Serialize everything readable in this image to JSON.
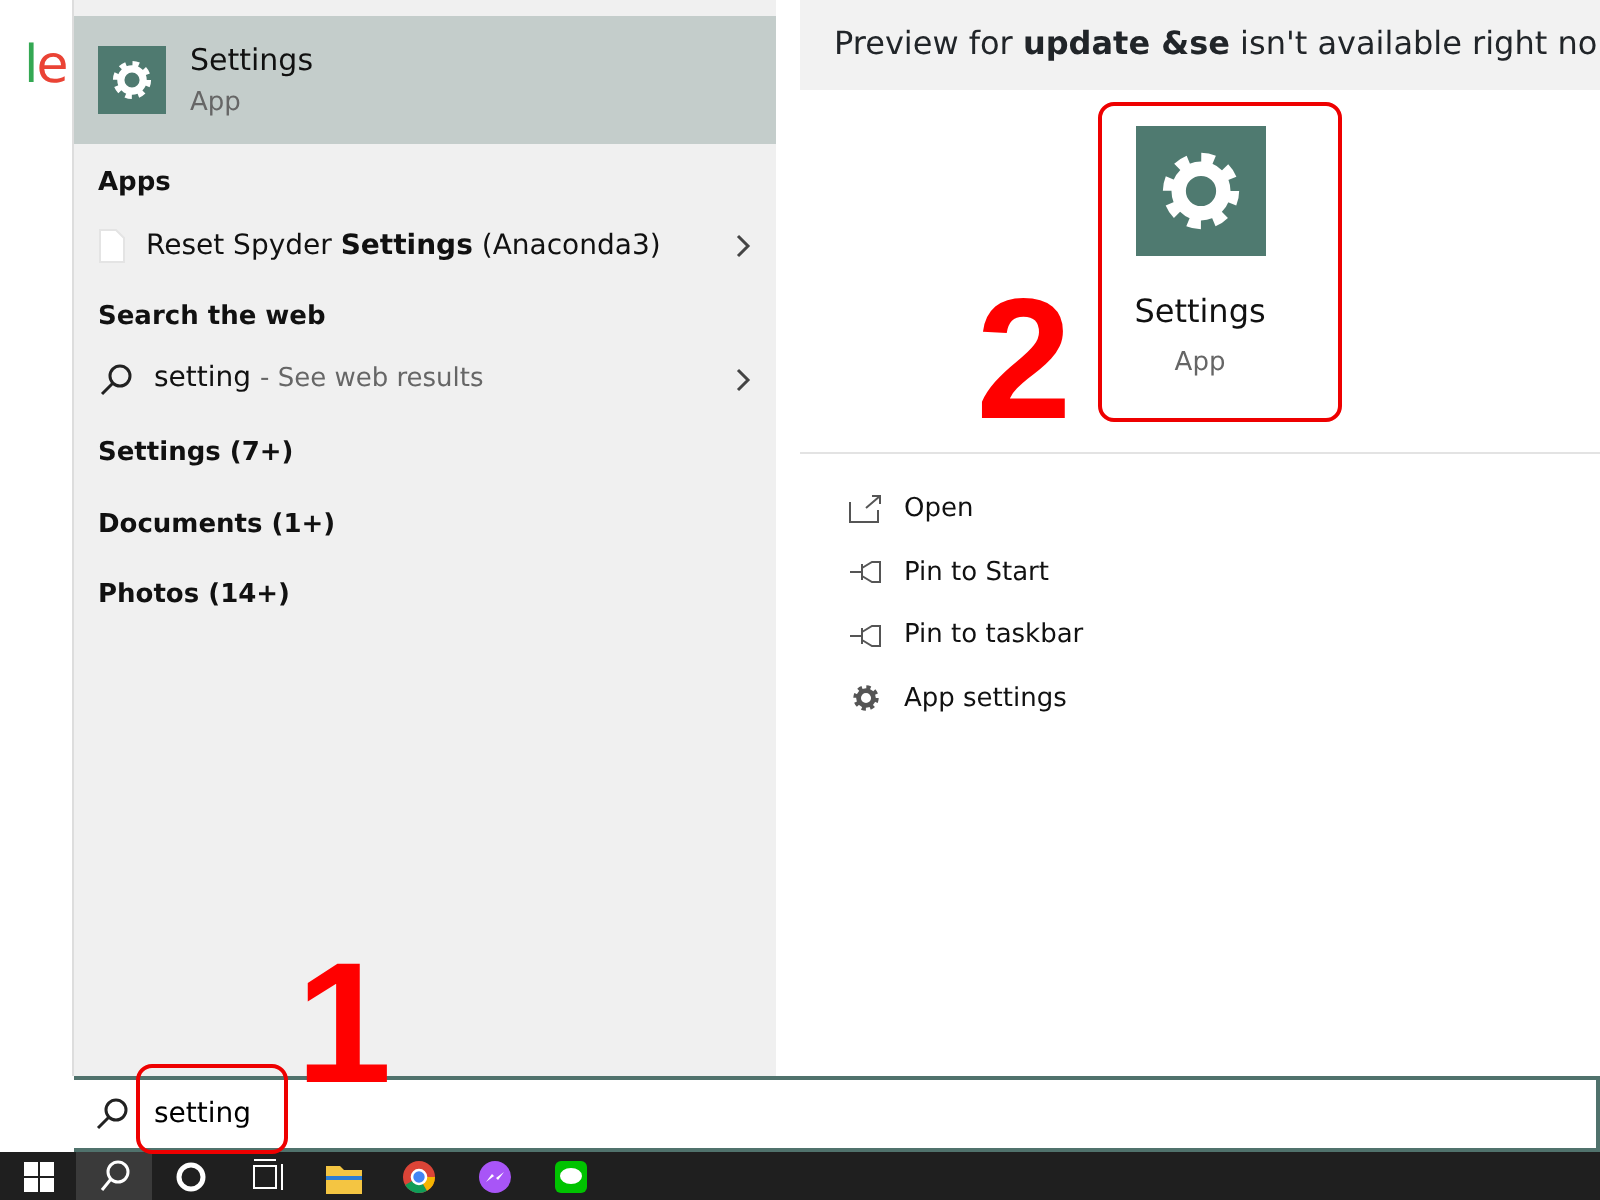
{
  "background": {
    "logo_fragment": "le"
  },
  "best_match": {
    "title": "Settings",
    "subtitle": "App",
    "selected": true
  },
  "sections": [
    {
      "heading": "Apps",
      "items": [
        {
          "kind": "app",
          "label": "Reset Spyder **Settings** (Anaconda3)"
        }
      ]
    },
    {
      "heading": "Search the web",
      "items": [
        {
          "kind": "web",
          "label": "setting",
          "hint": "- See web results"
        }
      ]
    }
  ],
  "categories": [
    "Settings (7+)",
    "Documents (1+)",
    "Photos (14+)"
  ],
  "preview": {
    "header": "Preview for **update &se** isn't available right no",
    "title": "Settings",
    "subtitle": "App",
    "actions": [
      {
        "kind": "open",
        "label": "Open"
      },
      {
        "kind": "pin",
        "label": "Pin to Start"
      },
      {
        "kind": "pin",
        "label": "Pin to taskbar"
      },
      {
        "kind": "settings",
        "label": "App settings"
      }
    ]
  },
  "search": {
    "value": "setting"
  },
  "annotations": [
    {
      "kind": "search",
      "label": "1"
    },
    {
      "kind": "preview",
      "label": "2"
    }
  ]
}
